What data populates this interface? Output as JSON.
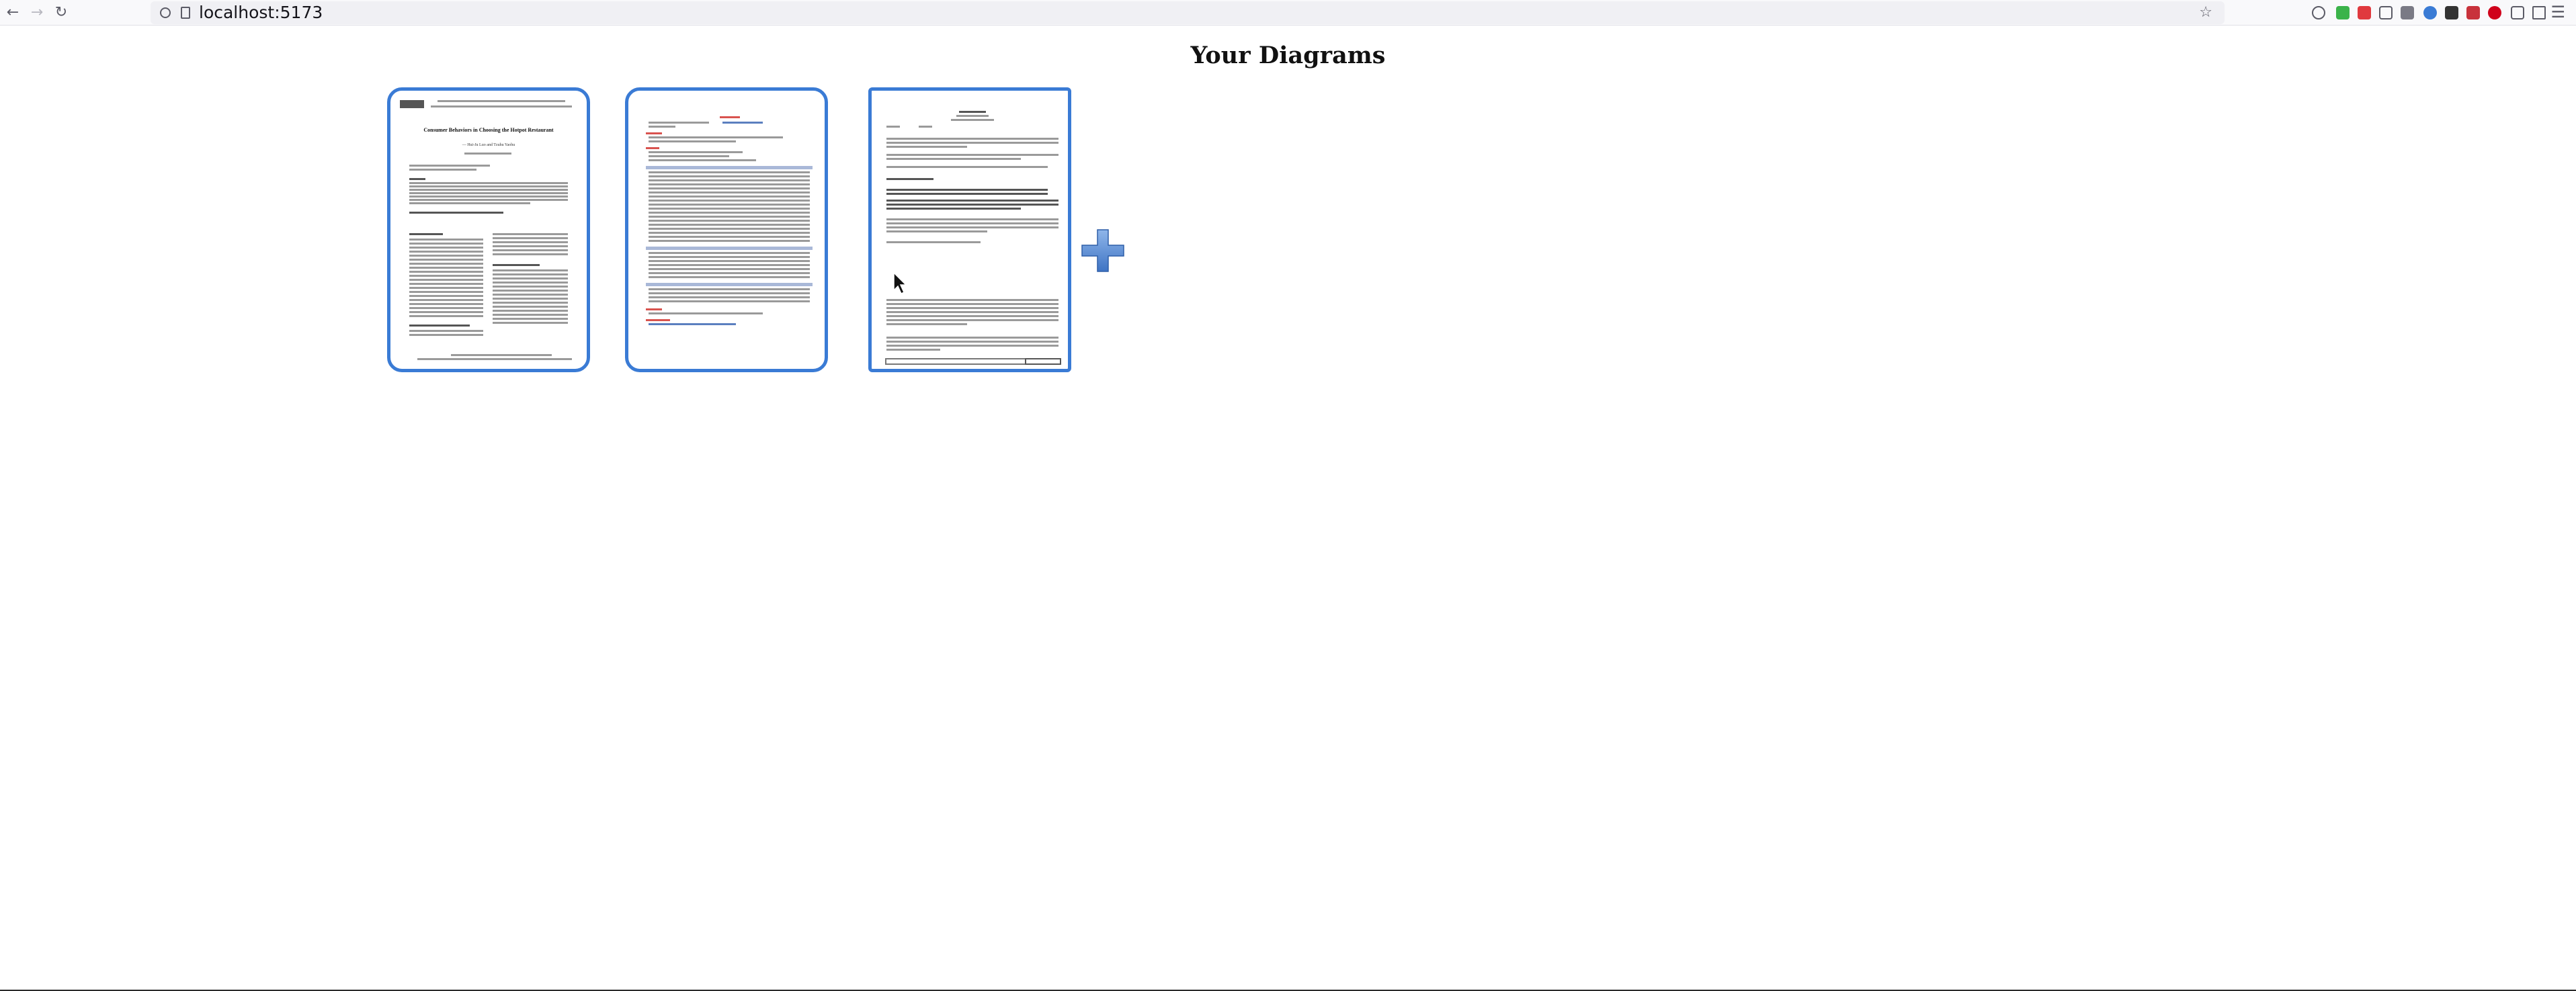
{
  "browser": {
    "url": "localhost:5173",
    "icons": [
      "back-icon",
      "forward-icon",
      "reload-icon",
      "shield-icon",
      "page-info-icon",
      "bookmark-star-icon",
      "menu-icon"
    ]
  },
  "page": {
    "title": "Your Diagrams"
  },
  "diagrams": [
    {
      "title": "Consumer Behaviors in Choosing the Hotpot Restaurant",
      "subtitle": "— Hui-Ju Luo and Tzuhu Yaohu"
    },
    {
      "title": "",
      "subtitle": ""
    },
    {
      "title": "",
      "subtitle": ""
    }
  ],
  "add_button": {
    "icon": "plus-icon",
    "color": "#5b8fd6"
  },
  "colors": {
    "accent": "#3a7bd5"
  }
}
